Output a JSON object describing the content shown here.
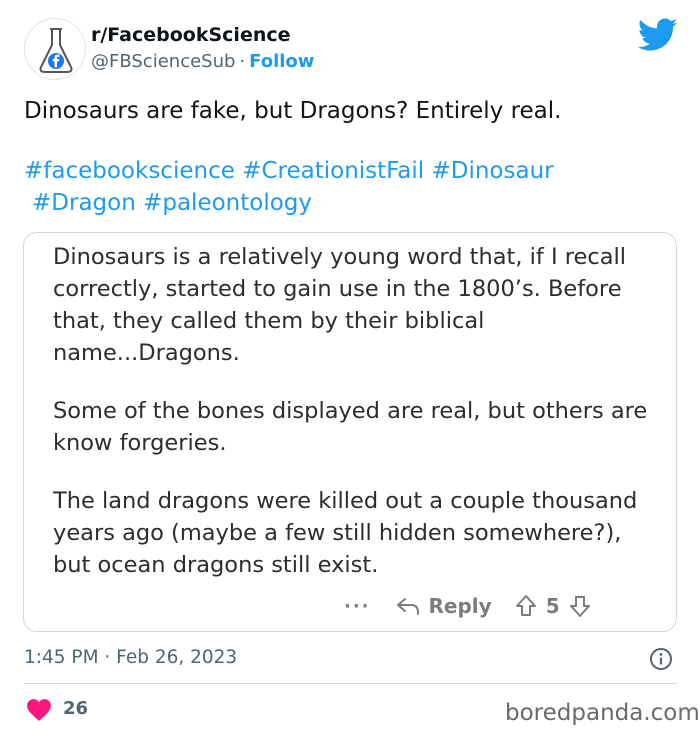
{
  "author": {
    "display_name": "r/FacebookScience",
    "handle": "@FBScienceSub",
    "separator": "·",
    "follow_label": "Follow"
  },
  "tweet": {
    "text": "Dinosaurs are fake, but Dragons? Entirely real.",
    "hashtags": [
      "#facebookscience",
      "#CreationistFail",
      "#Dinosaur",
      "#Dragon",
      "#paleontology"
    ]
  },
  "embedded_comment": {
    "paragraphs": [
      "Dinosaurs is a relatively young word that, if I recall correctly, started to gain use in the 1800’s. Before that, they called them by their biblical name...Dragons.",
      "Some of the bones displayed are real, but others are know forgeries.",
      "The land dragons were killed out a couple thousand years ago (maybe a few still hidden somewhere?), but ocean dragons still exist."
    ],
    "more_label": "···",
    "reply_label": "Reply",
    "vote_count": "5"
  },
  "meta": {
    "timestamp": "1:45 PM · Feb 26, 2023"
  },
  "engagement": {
    "like_count": "26"
  },
  "watermark": "boredpanda.com",
  "colors": {
    "accent": "#1d9bf0",
    "heart": "#f91880",
    "text": "#0f1419",
    "muted": "#536471"
  },
  "icons": [
    "flask-facebook-avatar-icon",
    "twitter-bird-icon",
    "reply-arrow-icon",
    "upvote-arrow-icon",
    "downvote-arrow-icon",
    "info-icon",
    "heart-icon"
  ]
}
